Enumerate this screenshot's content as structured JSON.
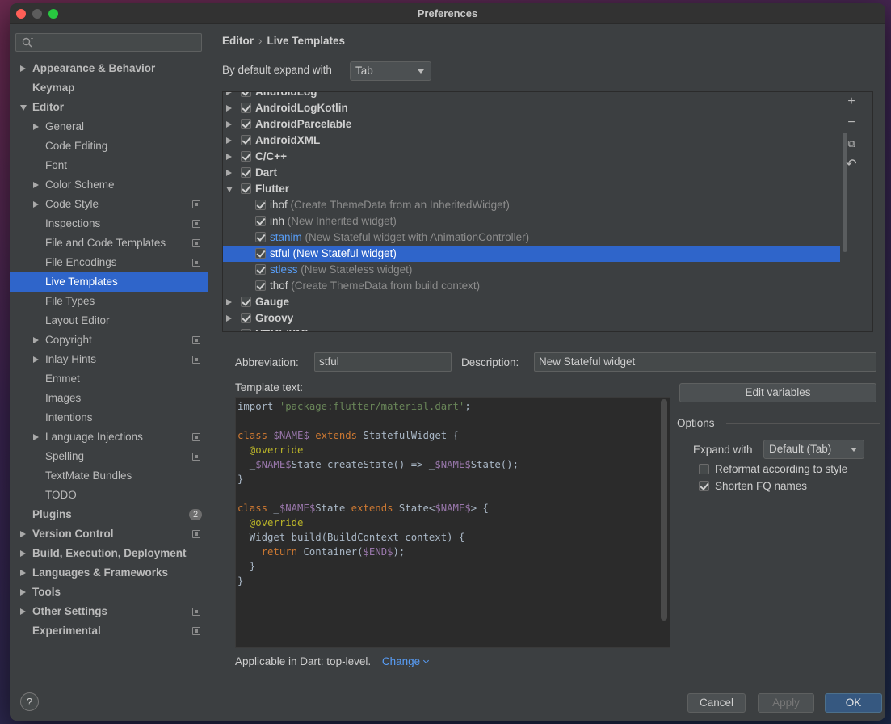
{
  "window": {
    "title": "Preferences"
  },
  "search": {
    "placeholder": ""
  },
  "sidebar": {
    "items": [
      {
        "label": "Appearance & Behavior",
        "level": 0,
        "arrow": "closed",
        "bold": true,
        "settings": false
      },
      {
        "label": "Keymap",
        "level": 0,
        "arrow": "none",
        "bold": true,
        "settings": false
      },
      {
        "label": "Editor",
        "level": 0,
        "arrow": "open",
        "bold": true,
        "settings": false
      },
      {
        "label": "General",
        "level": 1,
        "arrow": "closed",
        "settings": false
      },
      {
        "label": "Code Editing",
        "level": 1,
        "arrow": "none",
        "settings": false
      },
      {
        "label": "Font",
        "level": 1,
        "arrow": "none",
        "settings": false
      },
      {
        "label": "Color Scheme",
        "level": 1,
        "arrow": "closed",
        "settings": false
      },
      {
        "label": "Code Style",
        "level": 1,
        "arrow": "closed",
        "settings": true
      },
      {
        "label": "Inspections",
        "level": 1,
        "arrow": "none",
        "settings": true
      },
      {
        "label": "File and Code Templates",
        "level": 1,
        "arrow": "none",
        "settings": true
      },
      {
        "label": "File Encodings",
        "level": 1,
        "arrow": "none",
        "settings": true
      },
      {
        "label": "Live Templates",
        "level": 1,
        "arrow": "none",
        "settings": false,
        "selected": true
      },
      {
        "label": "File Types",
        "level": 1,
        "arrow": "none",
        "settings": false
      },
      {
        "label": "Layout Editor",
        "level": 1,
        "arrow": "none",
        "settings": false
      },
      {
        "label": "Copyright",
        "level": 1,
        "arrow": "closed",
        "settings": true
      },
      {
        "label": "Inlay Hints",
        "level": 1,
        "arrow": "closed",
        "settings": true
      },
      {
        "label": "Emmet",
        "level": 1,
        "arrow": "none",
        "settings": false
      },
      {
        "label": "Images",
        "level": 1,
        "arrow": "none",
        "settings": false
      },
      {
        "label": "Intentions",
        "level": 1,
        "arrow": "none",
        "settings": false
      },
      {
        "label": "Language Injections",
        "level": 1,
        "arrow": "closed",
        "settings": true
      },
      {
        "label": "Spelling",
        "level": 1,
        "arrow": "none",
        "settings": true
      },
      {
        "label": "TextMate Bundles",
        "level": 1,
        "arrow": "none",
        "settings": false
      },
      {
        "label": "TODO",
        "level": 1,
        "arrow": "none",
        "settings": false
      },
      {
        "label": "Plugins",
        "level": 0,
        "arrow": "none",
        "bold": true,
        "settings": false,
        "badge": "2"
      },
      {
        "label": "Version Control",
        "level": 0,
        "arrow": "closed",
        "bold": true,
        "settings": true
      },
      {
        "label": "Build, Execution, Deployment",
        "level": 0,
        "arrow": "closed",
        "bold": true,
        "settings": false
      },
      {
        "label": "Languages & Frameworks",
        "level": 0,
        "arrow": "closed",
        "bold": true,
        "settings": false
      },
      {
        "label": "Tools",
        "level": 0,
        "arrow": "closed",
        "bold": true,
        "settings": false
      },
      {
        "label": "Other Settings",
        "level": 0,
        "arrow": "closed",
        "bold": true,
        "settings": true
      },
      {
        "label": "Experimental",
        "level": 0,
        "arrow": "none",
        "bold": true,
        "settings": true
      }
    ]
  },
  "breadcrumb": {
    "parent": "Editor",
    "separator": "›",
    "current": "Live Templates"
  },
  "expand": {
    "label": "By default expand with",
    "value": "Tab"
  },
  "templates": [
    {
      "kind": "group",
      "name": "AndroidLog",
      "arrow": "closed",
      "checked": true,
      "partial": true
    },
    {
      "kind": "group",
      "name": "AndroidLogKotlin",
      "arrow": "closed",
      "checked": true
    },
    {
      "kind": "group",
      "name": "AndroidParcelable",
      "arrow": "closed",
      "checked": true
    },
    {
      "kind": "group",
      "name": "AndroidXML",
      "arrow": "closed",
      "checked": true
    },
    {
      "kind": "group",
      "name": "C/C++",
      "arrow": "closed",
      "checked": true
    },
    {
      "kind": "group",
      "name": "Dart",
      "arrow": "closed",
      "checked": true
    },
    {
      "kind": "group",
      "name": "Flutter",
      "arrow": "open",
      "checked": true
    },
    {
      "kind": "item",
      "name": "ihof",
      "desc": "(Create ThemeData from an InheritedWidget)",
      "checked": true
    },
    {
      "kind": "item",
      "name": "inh",
      "desc": "(New Inherited widget)",
      "checked": true
    },
    {
      "kind": "item",
      "name": "stanim",
      "desc": "(New Stateful widget with AnimationController)",
      "checked": true,
      "blue": true
    },
    {
      "kind": "item",
      "name": "stful",
      "desc": "(New Stateful widget)",
      "checked": true,
      "selected": true
    },
    {
      "kind": "item",
      "name": "stless",
      "desc": "(New Stateless widget)",
      "checked": true,
      "blue": true
    },
    {
      "kind": "item",
      "name": "thof",
      "desc": "(Create ThemeData from build context)",
      "checked": true
    },
    {
      "kind": "group",
      "name": "Gauge",
      "arrow": "closed",
      "checked": true
    },
    {
      "kind": "group",
      "name": "Groovy",
      "arrow": "closed",
      "checked": true
    },
    {
      "kind": "group",
      "name": "HTML/XML",
      "arrow": "closed",
      "checked": true,
      "partial": true
    }
  ],
  "toolbar": {
    "add": "+",
    "remove": "−",
    "copy": "⧉",
    "restore": "↶"
  },
  "abbreviation": {
    "label": "Abbreviation:",
    "value": "stful"
  },
  "description": {
    "label": "Description:",
    "value": "New Stateful widget"
  },
  "template_text": {
    "label": "Template text:",
    "lines": [
      [
        [
          "",
          "import "
        ],
        [
          "str",
          "'package:flutter/material.dart'"
        ],
        [
          "",
          ";"
        ]
      ],
      [],
      [
        [
          "kw",
          "class "
        ],
        [
          "var",
          "$NAME$"
        ],
        [
          "kw",
          " extends "
        ],
        [
          "",
          "StatefulWidget {"
        ]
      ],
      [
        [
          "ann",
          "  @override"
        ]
      ],
      [
        [
          "",
          "  _"
        ],
        [
          "var",
          "$NAME$"
        ],
        [
          "",
          "State createState() => _"
        ],
        [
          "var",
          "$NAME$"
        ],
        [
          "",
          "State();"
        ]
      ],
      [
        [
          "",
          "}"
        ]
      ],
      [],
      [
        [
          "kw",
          "class "
        ],
        [
          "",
          "_"
        ],
        [
          "var",
          "$NAME$"
        ],
        [
          "",
          "State "
        ],
        [
          "kw",
          "extends "
        ],
        [
          "",
          "State<"
        ],
        [
          "var",
          "$NAME$"
        ],
        [
          "",
          "> {"
        ]
      ],
      [
        [
          "ann",
          "  @override"
        ]
      ],
      [
        [
          "",
          "  Widget build(BuildContext context) {"
        ]
      ],
      [
        [
          "kw",
          "    return "
        ],
        [
          "",
          "Container("
        ],
        [
          "var",
          "$END$"
        ],
        [
          "",
          ");"
        ]
      ],
      [
        [
          "",
          "  }"
        ]
      ],
      [
        [
          "",
          "}"
        ]
      ]
    ]
  },
  "edit_variables": "Edit variables",
  "options": {
    "title": "Options",
    "expand_with_label": "Expand with",
    "expand_with_value": "Default (Tab)",
    "reformat": {
      "label": "Reformat according to style",
      "checked": false
    },
    "shorten": {
      "label": "Shorten FQ names",
      "checked": true
    }
  },
  "applicable": {
    "text": "Applicable in Dart: top-level.",
    "change": "Change"
  },
  "footer": {
    "help": "?",
    "cancel": "Cancel",
    "apply": "Apply",
    "ok": "OK"
  },
  "colors": {
    "accent": "#2f65ca",
    "primary_button": "#365880",
    "link": "#589df6"
  }
}
